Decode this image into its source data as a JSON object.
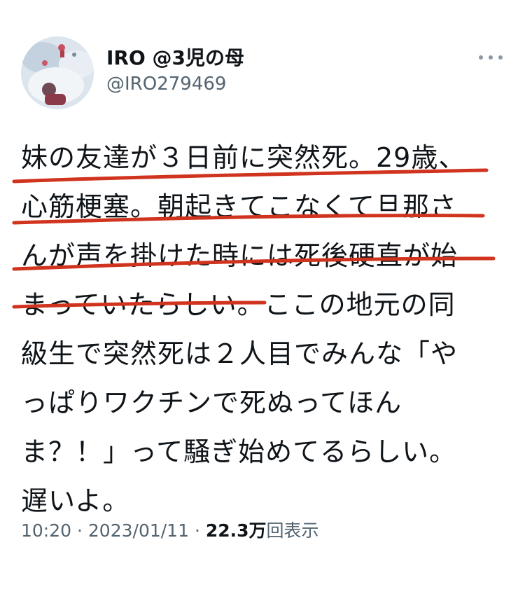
{
  "author": {
    "display_name": "IRO @3児の母",
    "handle": "@IRO279469",
    "avatar_icon": "profile-photo"
  },
  "more_icon": "more-options-icon",
  "tweet": {
    "lines": [
      "妹の友達が３日前に突然死。29歳、",
      "心筋梗塞。朝起きてこなくて旦那さ",
      "んが声を掛けた時には死後硬直が始",
      "まっていたらしい。ここの地元の同",
      "級生で突然死は２人目でみんな「や",
      "っぱりワクチンで死ぬってほん",
      "ま？！」って騒ぎ始めてるらしい。",
      "遅いよ。"
    ]
  },
  "meta": {
    "time": "10:20",
    "separator": "·",
    "date": "2023/01/11",
    "views_count": "22.3万",
    "views_label": "回表示"
  },
  "colors": {
    "underline": "#d0341f",
    "secondary_text": "#536471",
    "primary_text": "#0f1419"
  }
}
